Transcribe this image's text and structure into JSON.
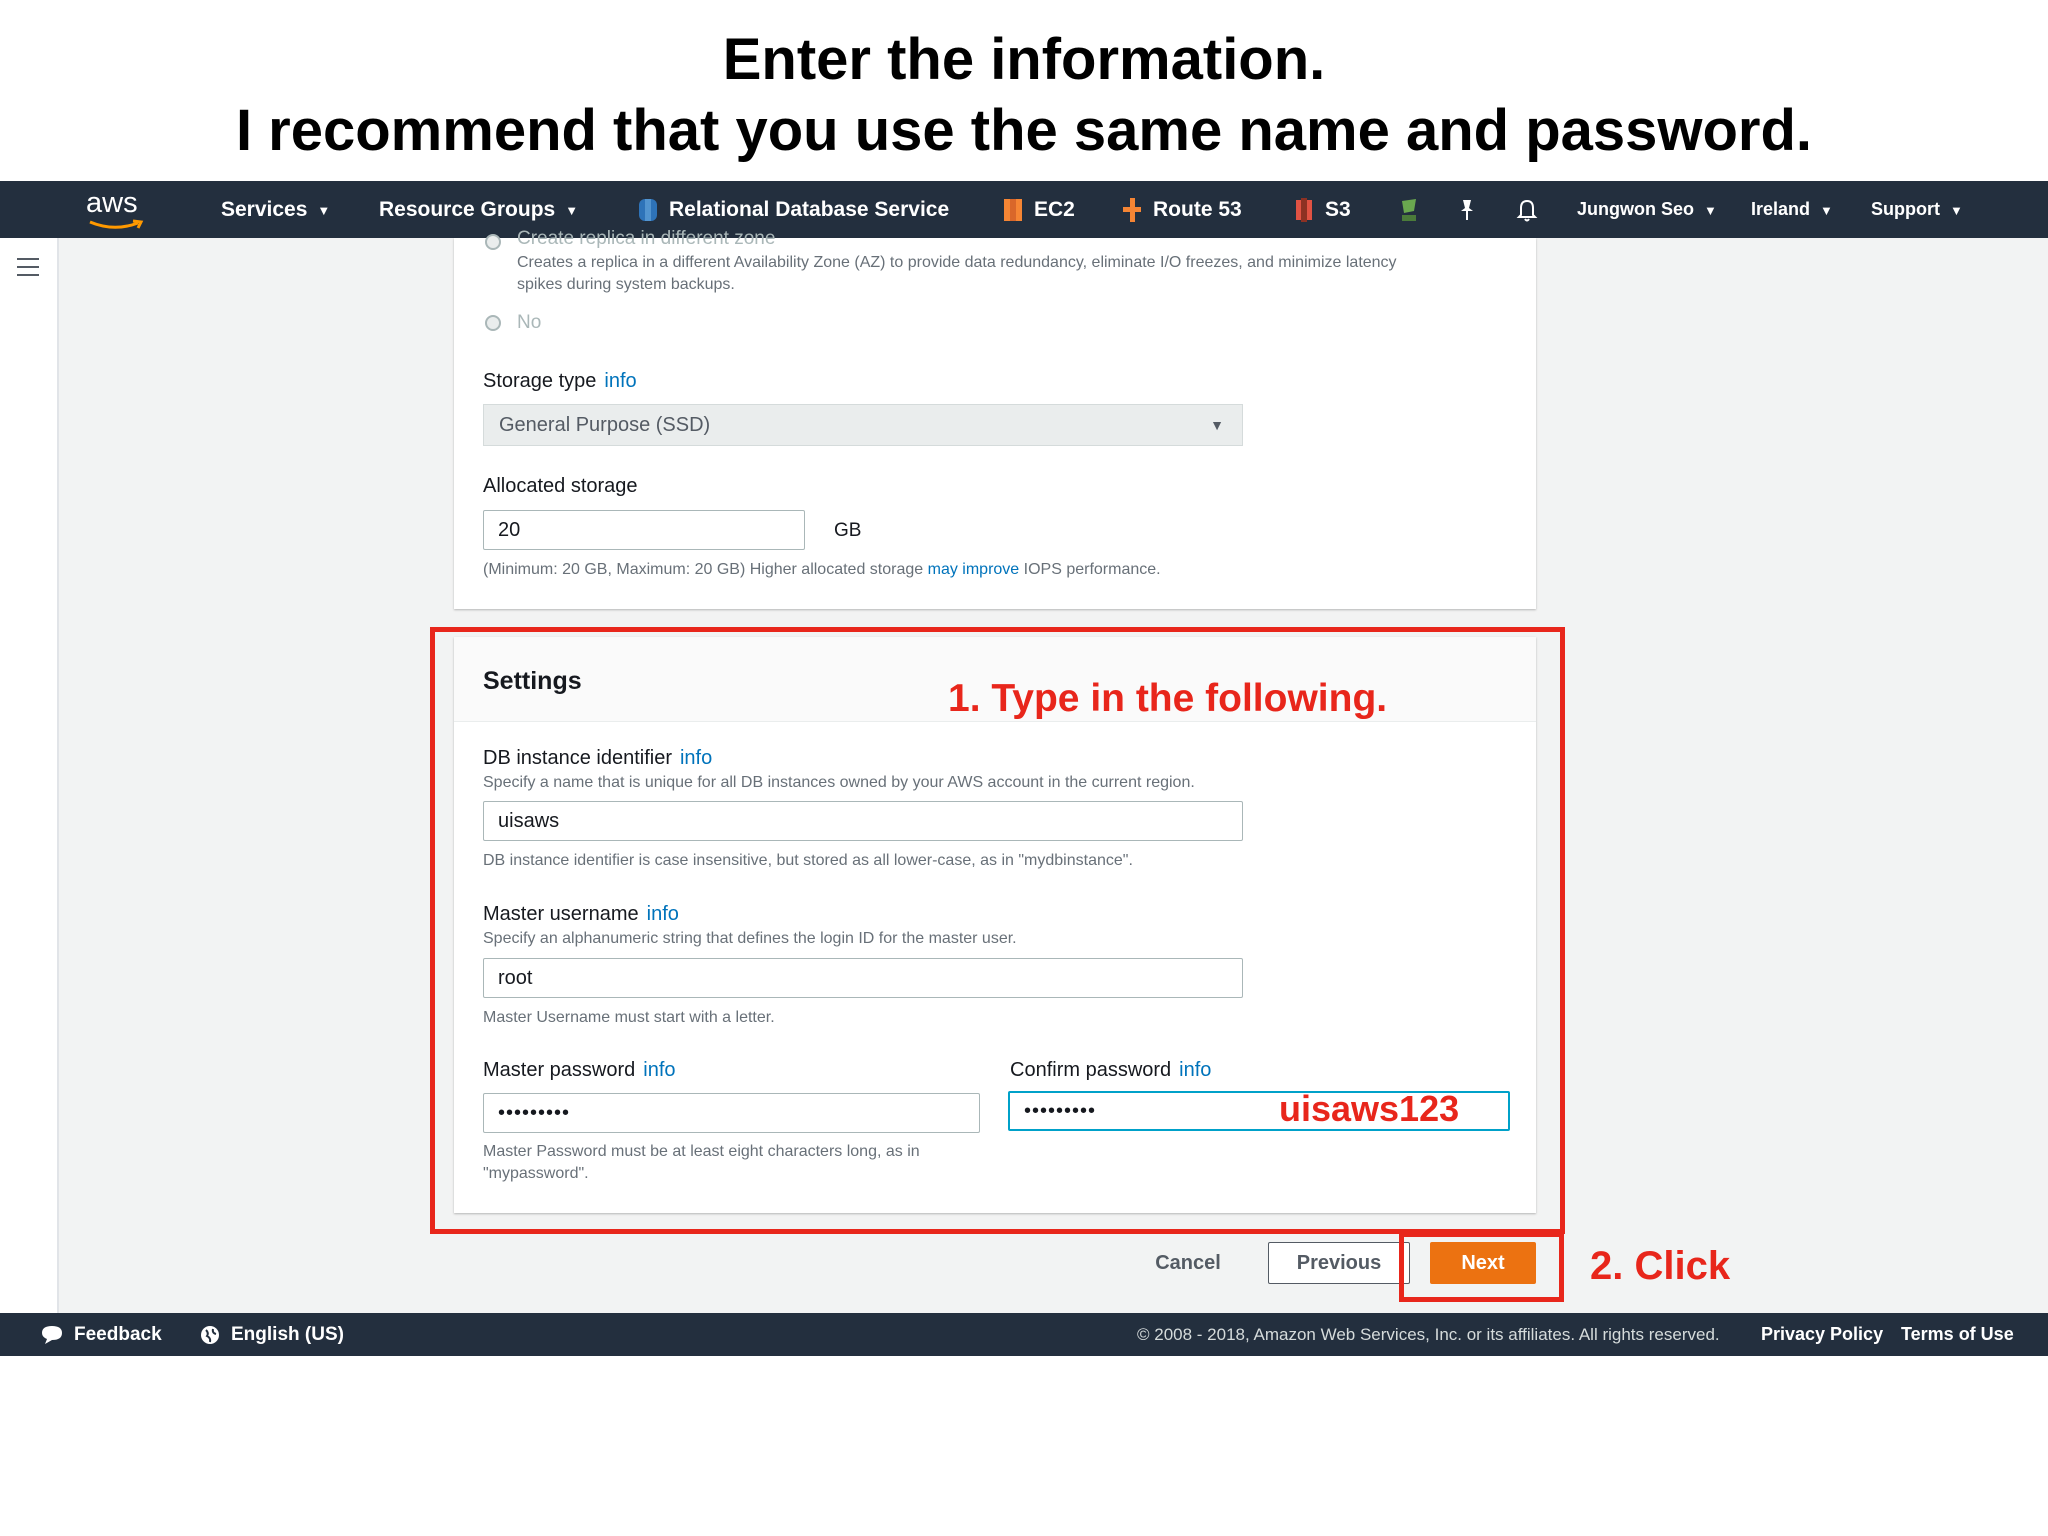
{
  "slide": {
    "title_line1": "Enter the information.",
    "title_line2": "I recommend that you use the same name and password."
  },
  "nav": {
    "logo": "aws",
    "services": "Services",
    "resource_groups": "Resource Groups",
    "rds": "Relational Database Service",
    "ec2": "EC2",
    "route53": "Route 53",
    "s3": "S3",
    "user": "Jungwon Seo",
    "region": "Ireland",
    "support": "Support",
    "icons": [
      "rds-icon",
      "ec2-icon",
      "route53-icon",
      "s3-icon",
      "elastic-beanstalk-icon",
      "pin-icon",
      "bell-icon"
    ]
  },
  "storage_panel": {
    "replica_option_label": "Create replica in different zone",
    "replica_option_desc_line1": "Creates a replica in a different Availability Zone (AZ) to provide data redundancy, eliminate I/O freezes, and minimize latency",
    "replica_option_desc_line2": "spikes during system backups.",
    "no_option_label": "No",
    "storage_type_label": "Storage type",
    "storage_type_info": "info",
    "storage_type_value": "General Purpose (SSD)",
    "allocated_storage_label": "Allocated storage",
    "allocated_storage_value": "20",
    "allocated_storage_unit": "GB",
    "allocated_storage_hint_prefix": "(Minimum: 20 GB, Maximum: 20 GB) Higher allocated storage",
    "allocated_storage_hint_link": "may improve",
    "allocated_storage_hint_suffix": "IOPS performance."
  },
  "settings": {
    "title": "Settings",
    "db_id_label": "DB instance identifier",
    "db_id_info": "info",
    "db_id_desc": "Specify a name that is unique for all DB instances owned by your AWS account in the current region.",
    "db_id_value": "uisaws",
    "db_id_hint": "DB instance identifier is case insensitive, but stored as all lower-case, as in \"mydbinstance\".",
    "username_label": "Master username",
    "username_info": "info",
    "username_desc": "Specify an alphanumeric string that defines the login ID for the master user.",
    "username_value": "root",
    "username_hint": "Master Username must start with a letter.",
    "password_label": "Master password",
    "password_info": "info",
    "password_value": "•••••••••",
    "password_hint_line1": "Master Password must be at least eight characters long, as in",
    "password_hint_line2": "\"mypassword\".",
    "confirm_label": "Confirm password",
    "confirm_info": "info",
    "confirm_value": "•••••••••"
  },
  "actions": {
    "cancel": "Cancel",
    "previous": "Previous",
    "next": "Next"
  },
  "annotations": {
    "step1": "1. Type in the following.",
    "password_text": "uisaws123",
    "step2": "2. Click",
    "color": "#e8261b"
  },
  "footer": {
    "feedback": "Feedback",
    "language": "English (US)",
    "copyright": "© 2008 - 2018, Amazon Web Services, Inc. or its affiliates. All rights reserved.",
    "privacy": "Privacy Policy",
    "terms": "Terms of Use"
  },
  "colors": {
    "nav_bg": "#232f3e",
    "primary_button": "#ec7211",
    "link": "#0073bb",
    "focus_border": "#00a1c9"
  }
}
